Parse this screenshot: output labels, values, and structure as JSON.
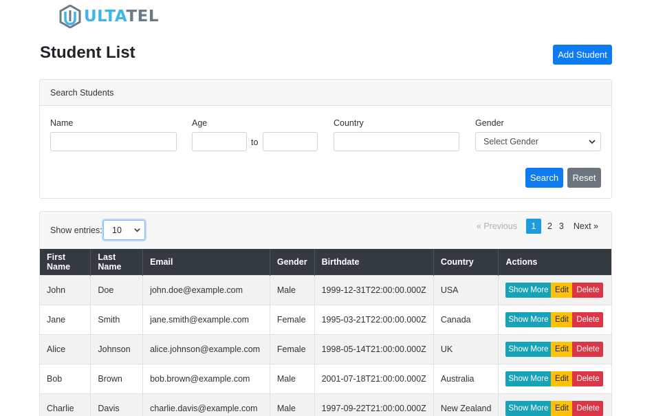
{
  "brand": {
    "part1": "ULTA",
    "part2": "TEL",
    "logo_color": "#3fb7e6",
    "logo_gray": "#6c7a86"
  },
  "page_title": "Student List",
  "add_button": "Add Student",
  "search": {
    "header": "Search Students",
    "name_label": "Name",
    "age_label": "Age",
    "age_to": "to",
    "country_label": "Country",
    "gender_label": "Gender",
    "gender_selected": "Select Gender",
    "search_button": "Search",
    "reset_button": "Reset"
  },
  "table": {
    "show_entries_label": "Show entries:",
    "entries_value": "10",
    "pager": {
      "prev": "« Previous",
      "pages": [
        "1",
        "2",
        "3"
      ],
      "active_page": "1",
      "next": "Next »"
    },
    "headers": [
      "First Name",
      "Last Name",
      "Email",
      "Gender",
      "Birthdate",
      "Country",
      "Actions"
    ],
    "rows": [
      [
        "John",
        "Doe",
        "john.doe@example.com",
        "Male",
        "1999-12-31T22:00:00.000Z",
        "USA"
      ],
      [
        "Jane",
        "Smith",
        "jane.smith@example.com",
        "Female",
        "1995-03-21T22:00:00.000Z",
        "Canada"
      ],
      [
        "Alice",
        "Johnson",
        "alice.johnson@example.com",
        "Female",
        "1998-05-14T21:00:00.000Z",
        "UK"
      ],
      [
        "Bob",
        "Brown",
        "bob.brown@example.com",
        "Male",
        "2001-07-18T21:00:00.000Z",
        "Australia"
      ],
      [
        "Charlie",
        "Davis",
        "charlie.davis@example.com",
        "Male",
        "1997-09-22T21:00:00.000Z",
        "New Zealand"
      ]
    ],
    "action_labels": {
      "more": "Show More",
      "edit": "Edit",
      "delete": "Delete"
    }
  },
  "colors": {
    "primary": "#0d7cf2",
    "secondary": "#6c757d",
    "info": "#17a2b8",
    "warning": "#ffc107",
    "danger": "#dc3545",
    "header_dark": "#343a40"
  }
}
